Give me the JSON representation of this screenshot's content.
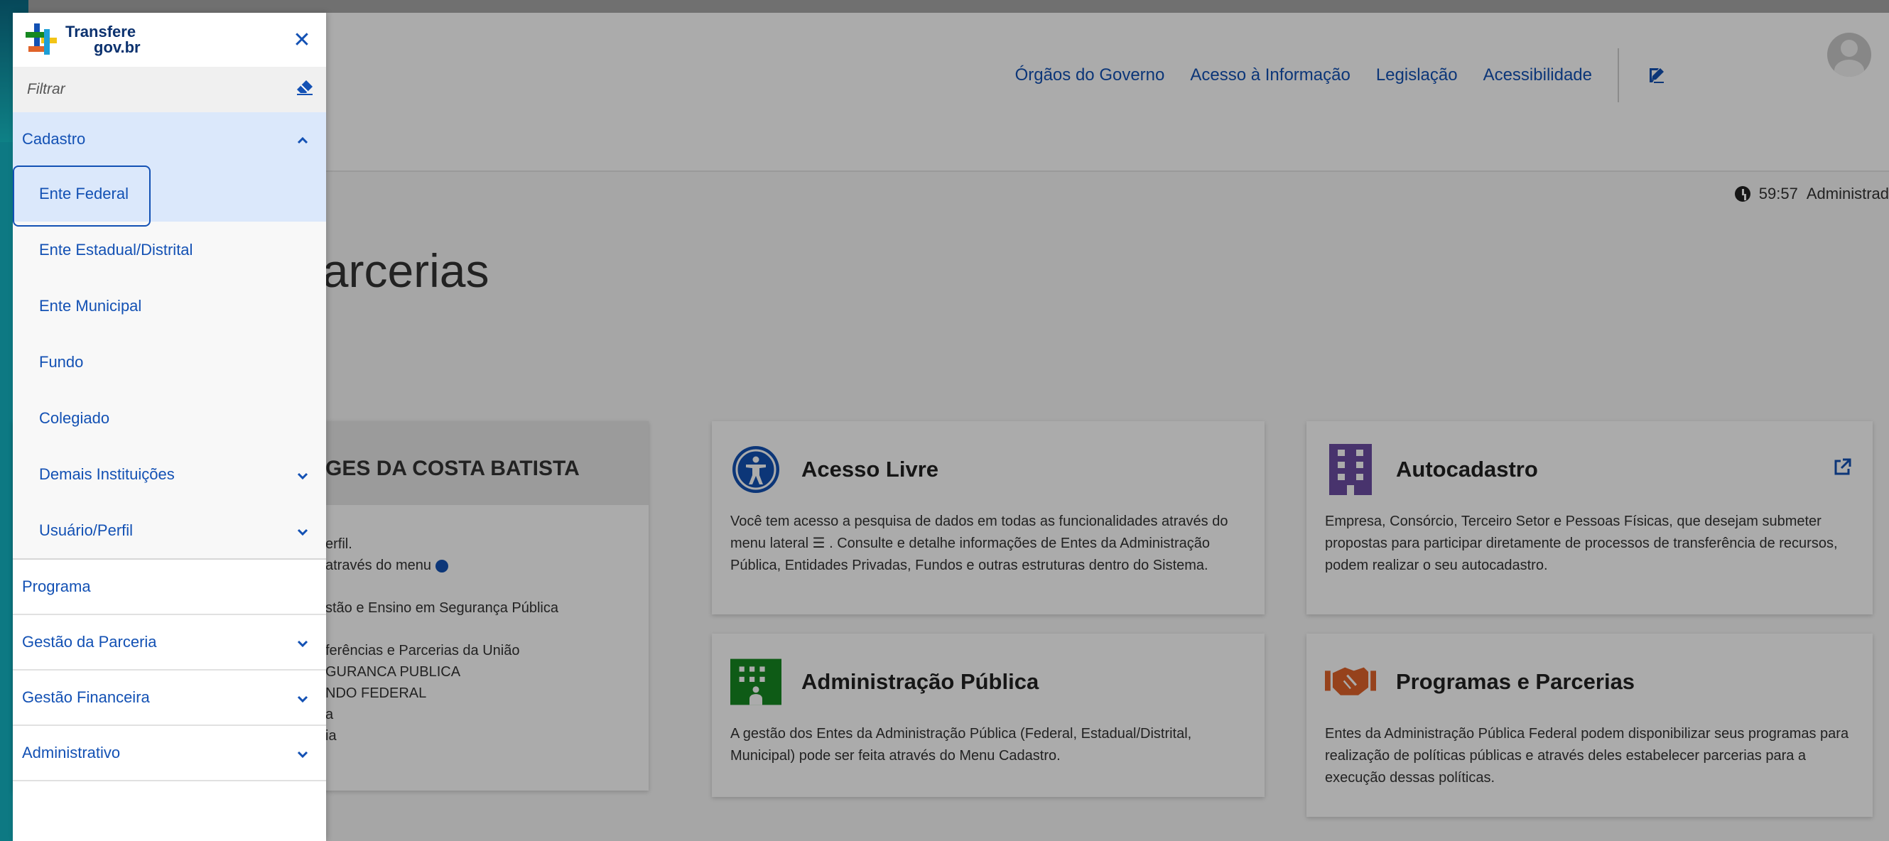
{
  "header": {
    "nav": [
      "Órgãos do Governo",
      "Acesso à Informação",
      "Legislação",
      "Acessibilidade"
    ]
  },
  "session": {
    "timer": "59:57",
    "user_role": "Administrad"
  },
  "page": {
    "title_partial": "de Parcerias"
  },
  "profile_card": {
    "name_partial": "GES DA COSTA BATISTA",
    "lines": [
      "erfil.",
      " através do menu",
      "",
      "stão e Ensino em Segurança Pública",
      "",
      "ferências e Parcerias da União",
      "GURANCA PUBLICA",
      "NDO FEDERAL",
      "a",
      "ia"
    ]
  },
  "cards": [
    {
      "title": "Acesso Livre",
      "icon": "accessibility-icon",
      "text": "Você tem acesso a pesquisa de dados em todas as funcionalidades através do menu lateral ☰ . Consulte e detalhe informações de Entes da Administração Pública, Entidades Privadas, Fundos e outras estruturas dentro do Sistema."
    },
    {
      "title": "Autocadastro",
      "icon": "building-icon",
      "text": "Empresa, Consórcio, Terceiro Setor e Pessoas Físicas, que desejam submeter propostas para participar diretamente de processos de transferência de recursos, podem realizar o seu autocadastro."
    },
    {
      "title": "Administração Pública",
      "icon": "public-building-icon",
      "text": "A gestão dos Entes da Administração Pública (Federal, Estadual/Distrital, Municipal) pode ser feita através do Menu Cadastro."
    },
    {
      "title": "Programas e Parcerias",
      "icon": "handshake-icon",
      "text": "Entes da Administração Pública Federal podem disponibilizar seus programas para realização de políticas públicas e através deles estabelecer parcerias para a execução dessas políticas."
    }
  ],
  "colors": {
    "primary": "#1351b4",
    "accent_green": "#168821",
    "accent_purple": "#6c4da3",
    "accent_orange": "#e0632a"
  },
  "drawer": {
    "logo_line1": "Transfere",
    "logo_line2": "gov.br",
    "filter_placeholder": "Filtrar",
    "groups": {
      "cadastro": "Cadastro",
      "sub_items": [
        "Ente Federal",
        "Ente Estadual/Distrital",
        "Ente Municipal",
        "Fundo",
        "Colegiado",
        "Demais Instituições",
        "Usuário/Perfil"
      ]
    },
    "items": [
      "Programa",
      "Gestão da Parceria",
      "Gestão Financeira",
      "Administrativo"
    ]
  }
}
